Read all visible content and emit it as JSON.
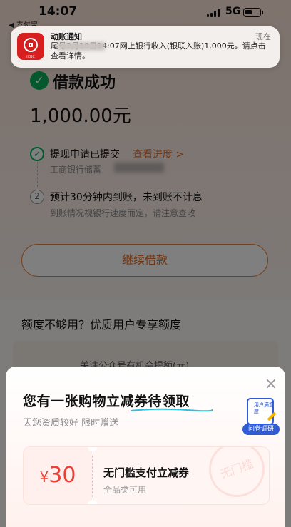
{
  "status_bar": {
    "time": "14:07",
    "network": "5G",
    "back_label": "◀ 支付宝"
  },
  "notification": {
    "title": "动账通知",
    "time": "现在",
    "body": "尾号3月18日14:07网上银行收入(银联入账)1,000元。请点击查看详情。",
    "app_tag": "ICBC"
  },
  "result": {
    "title": "借款成功",
    "amount": "1,000.00元",
    "step1_title": "提现申请已提交",
    "step1_link": "查看进度 >",
    "step1_sub": "工商银行储蓄",
    "step2_num": "2",
    "step2_title": "预计30分钟内到账，未到账不计息",
    "step2_sub": "到账情况视银行速度而定，请注意查收"
  },
  "continue_button": "继续借款",
  "quota": {
    "title": "额度不够用？优质用户专享额度",
    "card_text": "关注公众号有机会提额(元)"
  },
  "sheet": {
    "title": "您有一张购物立减券待领取",
    "subtitle": "因您资质较好 限时赠送",
    "close": "×",
    "survey_card_text": "用户满意度",
    "survey_label": "问卷调研",
    "coupon": {
      "currency": "¥",
      "value": "30",
      "name": "无门槛支付立减券",
      "desc": "全品类可用",
      "stamp": "无门槛"
    }
  },
  "colors": {
    "accent": "#e46a22",
    "success": "#0bb15a",
    "coupon_red": "#ef3e33",
    "survey_blue": "#2f5bd6"
  }
}
